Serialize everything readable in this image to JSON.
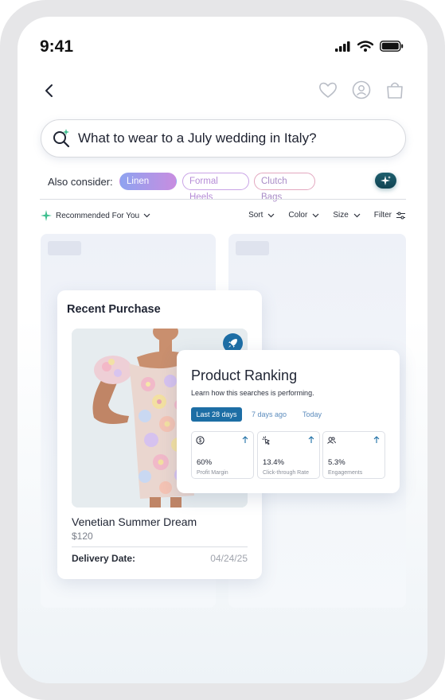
{
  "status_bar": {
    "time": "9:41"
  },
  "search": {
    "query": "What to wear to a July wedding in Italy?"
  },
  "also_consider": {
    "label": "Also consider:",
    "chips": [
      "Linen Suits",
      "Formal Heels",
      "Clutch Bags"
    ]
  },
  "toolbar": {
    "recommended": "Recommended For You",
    "filters": [
      "Sort",
      "Color",
      "Size",
      "Filter"
    ]
  },
  "recent_purchase": {
    "title": "Recent Purchase",
    "product_name": "Venetian Summer Dream",
    "price": "$120",
    "delivery_label": "Delivery Date:",
    "delivery_value": "04/24/25"
  },
  "product_ranking": {
    "title": "Product Ranking",
    "subtitle": "Learn how this searches is performing.",
    "tabs": [
      "Last 28 days",
      "7 days ago",
      "Today"
    ],
    "metrics": [
      {
        "value": "60%",
        "label": "Profit Margin",
        "icon": "dollar-icon"
      },
      {
        "value": "13.4%",
        "label": "Click-through Rate",
        "icon": "click-icon"
      },
      {
        "value": "5.3%",
        "label": "Engagements",
        "icon": "users-icon"
      }
    ]
  },
  "colors": {
    "accent": "#1d6ea5",
    "chip_gradient_start": "#8ea3f0",
    "chip_gradient_end": "#c88de0"
  }
}
